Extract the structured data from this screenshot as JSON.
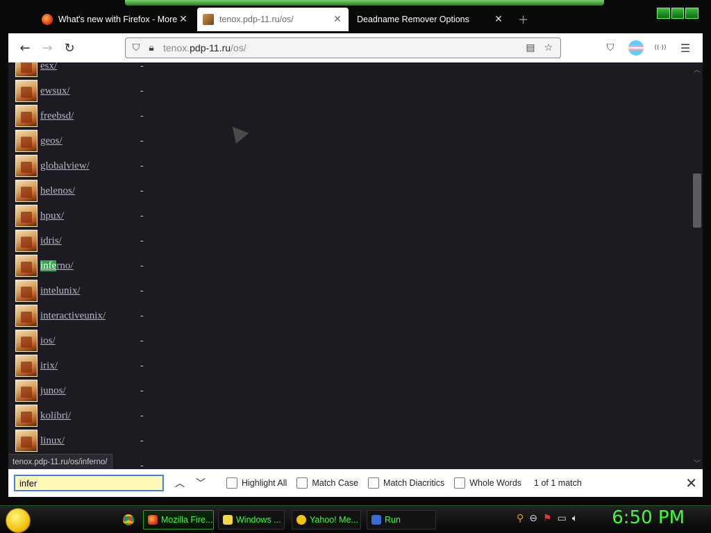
{
  "tabs": [
    {
      "label": "What's new with Firefox - More",
      "icon": "firefox-icon"
    },
    {
      "label": "tenox.pdp-11.ru/os/",
      "icon": "site-favicon-icon"
    },
    {
      "label": "Deadname Remover Options",
      "icon": ""
    }
  ],
  "url": {
    "prefix": "tenox.",
    "domain": "pdp-11.ru",
    "path": "/os/"
  },
  "listing": [
    {
      "name": "esx/",
      "size": "-"
    },
    {
      "name": "ewsux/",
      "size": "-"
    },
    {
      "name": "freebsd/",
      "size": "-"
    },
    {
      "name": "geos/",
      "size": "-"
    },
    {
      "name": "globalview/",
      "size": "-"
    },
    {
      "name": "helenos/",
      "size": "-"
    },
    {
      "name": "hpux/",
      "size": "-"
    },
    {
      "name": "idris/",
      "size": "-"
    },
    {
      "name": "inferno/",
      "size": "-",
      "highlight": "infe"
    },
    {
      "name": "intelunix/",
      "size": "-"
    },
    {
      "name": "interactiveunix/",
      "size": "-"
    },
    {
      "name": "ios/",
      "size": "-"
    },
    {
      "name": "irix/",
      "size": "-"
    },
    {
      "name": "junos/",
      "size": "-"
    },
    {
      "name": "kolibri/",
      "size": "-"
    },
    {
      "name": "linux/",
      "size": "-"
    },
    {
      "name": "",
      "size": "-"
    }
  ],
  "status_url": "tenox.pdp-11.ru/os/inferno/",
  "findbar": {
    "query": "infer",
    "highlight_all": "Highlight All",
    "match_case": "Match Case",
    "match_diacritics": "Match Diacritics",
    "whole_words": "Whole Words",
    "result": "1 of 1 match"
  },
  "taskbar": {
    "items": [
      {
        "label": "Mozilla Fire...",
        "active": true
      },
      {
        "label": "Windows ...",
        "active": false
      },
      {
        "label": "Yahoo! Me...",
        "active": false
      },
      {
        "label": "Run",
        "active": false
      }
    ],
    "clock": "6:50 PM"
  },
  "colors": {
    "accent": "#3cff3c",
    "find_highlight": "#2ea64e",
    "page_bg": "#1c1b22"
  }
}
